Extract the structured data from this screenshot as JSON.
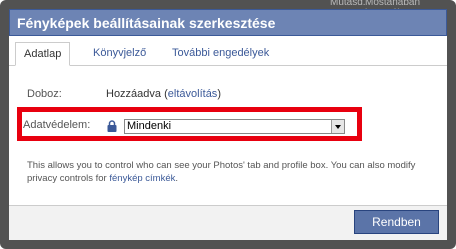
{
  "background_page": {
    "partial_text_left": "Mutasd.",
    "partial_text_right": "Mostanában használt"
  },
  "dialog": {
    "title": "Fényképek beállításainak szerkesztése",
    "tabs": [
      {
        "label": "Adatlap",
        "active": true
      },
      {
        "label": "Könyvjelző",
        "active": false
      },
      {
        "label": "További engedélyek",
        "active": false
      }
    ],
    "box_row": {
      "label": "Doboz:",
      "value": "Hozzáadva",
      "link_open": " (",
      "link": "eltávolítás",
      "link_close": ")"
    },
    "privacy_row": {
      "label": "Adatvédelem:",
      "selected": "Mindenki"
    },
    "description": {
      "text": "This allows you to control who can see your Photos' tab and profile box. You can also modify privacy controls for ",
      "link": "fénykép címkék",
      "end": "."
    },
    "ok_button": "Rendben"
  },
  "colors": {
    "titlebar": "#6d84b4",
    "link": "#3b5998",
    "highlight": "#e8000f",
    "button": "#5b74a8"
  },
  "icons": {
    "lock": "lock-icon",
    "dropdown": "triangle-down-icon"
  }
}
